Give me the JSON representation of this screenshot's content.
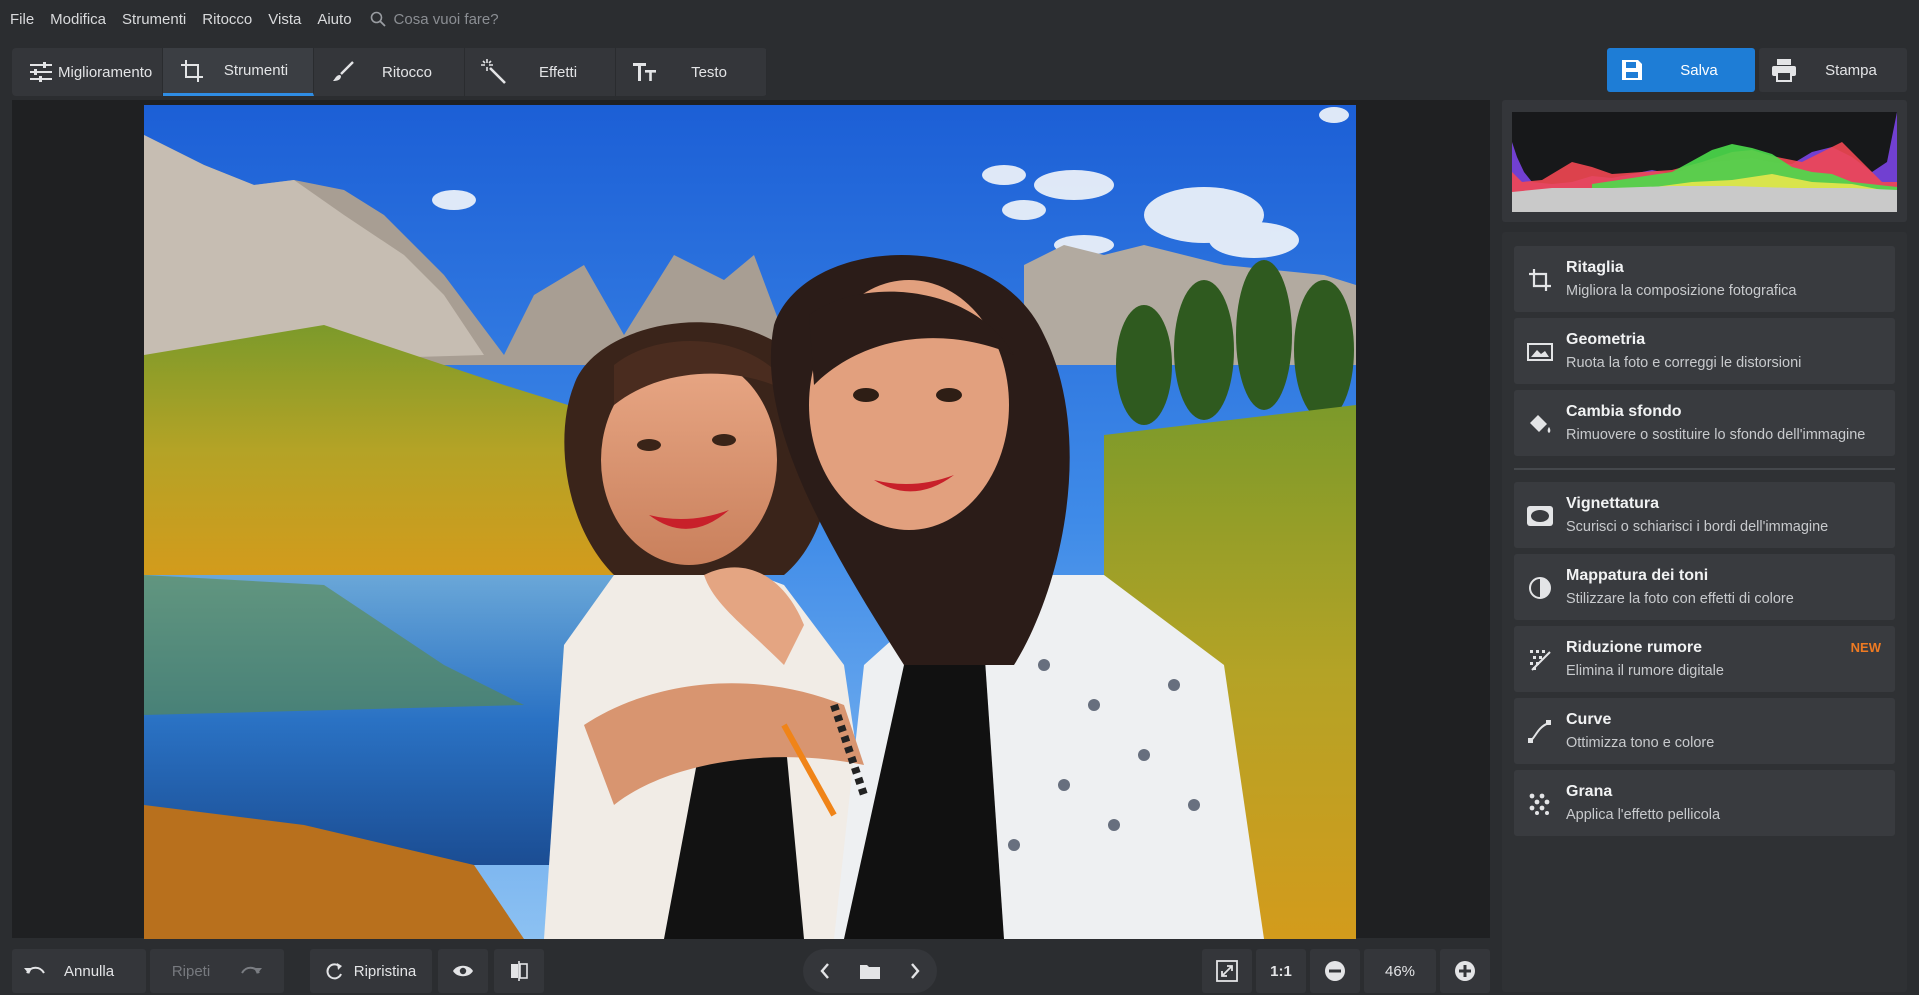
{
  "menu": {
    "items": [
      "File",
      "Modifica",
      "Strumenti",
      "Ritocco",
      "Vista",
      "Aiuto"
    ],
    "search_placeholder": "Cosa vuoi fare?"
  },
  "tabs": [
    {
      "label": "Miglioramento",
      "icon": "sliders-icon"
    },
    {
      "label": "Strumenti",
      "icon": "crop-icon",
      "active": true
    },
    {
      "label": "Ritocco",
      "icon": "brush-icon"
    },
    {
      "label": "Effetti",
      "icon": "magic-wand-icon"
    },
    {
      "label": "Testo",
      "icon": "text-icon"
    }
  ],
  "actions": {
    "save_label": "Salva",
    "print_label": "Stampa"
  },
  "tools": [
    {
      "title": "Ritaglia",
      "desc": "Migliora la composizione fotografica",
      "icon": "crop-icon"
    },
    {
      "title": "Geometria",
      "desc": "Ruota la foto e correggi le distorsioni",
      "icon": "geometry-icon"
    },
    {
      "title": "Cambia sfondo",
      "desc": "Rimuovere o sostituire lo sfondo dell'immagine",
      "icon": "paint-bucket-icon"
    },
    {
      "title": "Vignettatura",
      "desc": "Scurisci o schiarisci i bordi dell'immagine",
      "icon": "vignette-icon"
    },
    {
      "title": "Mappatura dei toni",
      "desc": "Stilizzare la foto con effetti di colore",
      "icon": "tone-mapping-icon"
    },
    {
      "title": "Riduzione rumore",
      "desc": "Elimina il rumore digitale",
      "icon": "noise-reduction-icon",
      "badge": "NEW"
    },
    {
      "title": "Curve",
      "desc": "Ottimizza tono e colore",
      "icon": "curves-icon"
    },
    {
      "title": "Grana",
      "desc": "Applica l'effetto pellicola",
      "icon": "grain-icon"
    }
  ],
  "bottom": {
    "undo_label": "Annulla",
    "redo_label": "Ripeti",
    "reset_label": "Ripristina",
    "ratio_label": "1:1",
    "zoom_value": "46%"
  },
  "colors": {
    "accent": "#1e7dd6",
    "badge": "#ee7a22",
    "bg": "#2b2d30"
  }
}
